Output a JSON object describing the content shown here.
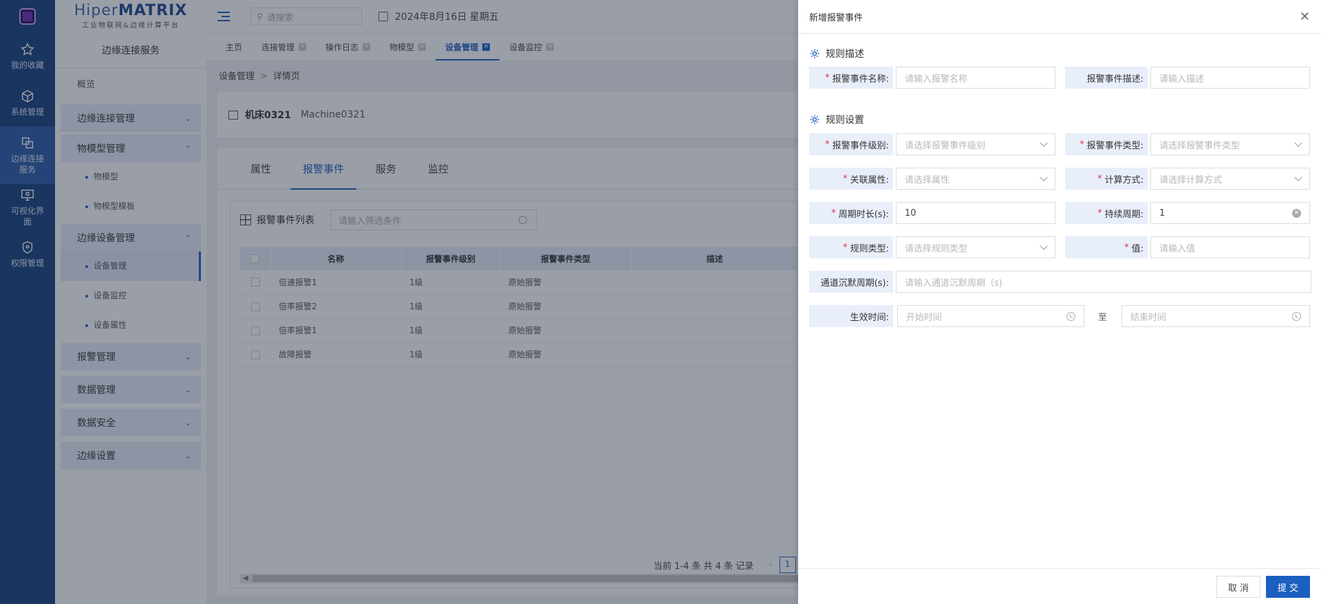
{
  "rail": {
    "items": [
      {
        "label": "我的收藏",
        "icon": "star-icon"
      },
      {
        "label": "系统管理",
        "icon": "cube-icon"
      },
      {
        "label": "边缘连接服务",
        "icon": "link-icon"
      },
      {
        "label": "可视化界面",
        "icon": "monitor-icon"
      },
      {
        "label": "权限管理",
        "icon": "shield-icon"
      }
    ]
  },
  "brand": {
    "name_light": "Hiper",
    "name_bold": "MATRIX",
    "subtitle": "工业物联网&边缘计算平台"
  },
  "sidebar": {
    "title": "边缘连接服务",
    "overview": "概览",
    "groups": [
      {
        "label": "边缘连接管理"
      },
      {
        "label": "物模型管理",
        "children": [
          "物模型",
          "物模型模板"
        ]
      },
      {
        "label": "边缘设备管理",
        "children": [
          "设备管理",
          "设备监控",
          "设备属性"
        ]
      },
      {
        "label": "报警管理"
      },
      {
        "label": "数据管理"
      },
      {
        "label": "数据安全"
      },
      {
        "label": "边缘设置"
      }
    ]
  },
  "topbar": {
    "search_placeholder": "请搜索",
    "date": "2024年8月16日 星期五"
  },
  "tabs": [
    "主页",
    "连接管理",
    "操作日志",
    "物模型",
    "设备管理",
    "设备监控"
  ],
  "breadcrumb": {
    "parent": "设备管理",
    "sep": ">",
    "current": "详情页"
  },
  "device": {
    "name": "机床0321",
    "code": "Machine0321"
  },
  "panel": {
    "tabs": [
      "属性",
      "报警事件",
      "服务",
      "监控"
    ],
    "list_title": "报警事件列表",
    "filter_placeholder": "请输入筛选条件",
    "columns": [
      "名称",
      "报警事件级别",
      "报警事件类型",
      "描述"
    ],
    "rows": [
      {
        "name": "倍速报警1",
        "level": "1级",
        "type": "原始报警"
      },
      {
        "name": "倍率报警2",
        "level": "1级",
        "type": "原始报警"
      },
      {
        "name": "倍率报警1",
        "level": "1级",
        "type": "原始报警"
      },
      {
        "name": "故障报警",
        "level": "1级",
        "type": "原始报警"
      }
    ],
    "pagination_text": "当前 1-4 条 共 4 条 记录",
    "page": "1"
  },
  "drawer": {
    "title": "新增报警事件",
    "section1": "规则描述",
    "section2": "规则设置",
    "fields": {
      "name": {
        "label": "报警事件名称:",
        "placeholder": "请输入报警名称"
      },
      "desc": {
        "label": "报警事件描述:",
        "placeholder": "请输入描述"
      },
      "level": {
        "label": "报警事件级别:",
        "placeholder": "请选择报警事件级别"
      },
      "type": {
        "label": "报警事件类型:",
        "placeholder": "请选择报警事件类型"
      },
      "attr": {
        "label": "关联属性:",
        "placeholder": "请选择属性"
      },
      "calc": {
        "label": "计算方式:",
        "placeholder": "请选择计算方式"
      },
      "period": {
        "label": "周期时长(s):",
        "value": "10"
      },
      "duration": {
        "label": "持续周期:",
        "value": "1"
      },
      "rule_type": {
        "label": "规则类型:",
        "placeholder": "请选择规则类型"
      },
      "value": {
        "label": "值:",
        "placeholder": "请输入值"
      },
      "silence": {
        "label": "通道沉默周期(s):",
        "placeholder": "请输入通道沉默周期（s)"
      },
      "effective": {
        "label": "生效时间:",
        "start_placeholder": "开始时间",
        "to": "至",
        "end_placeholder": "结束时间"
      }
    },
    "cancel": "取 消",
    "submit": "提 交"
  }
}
